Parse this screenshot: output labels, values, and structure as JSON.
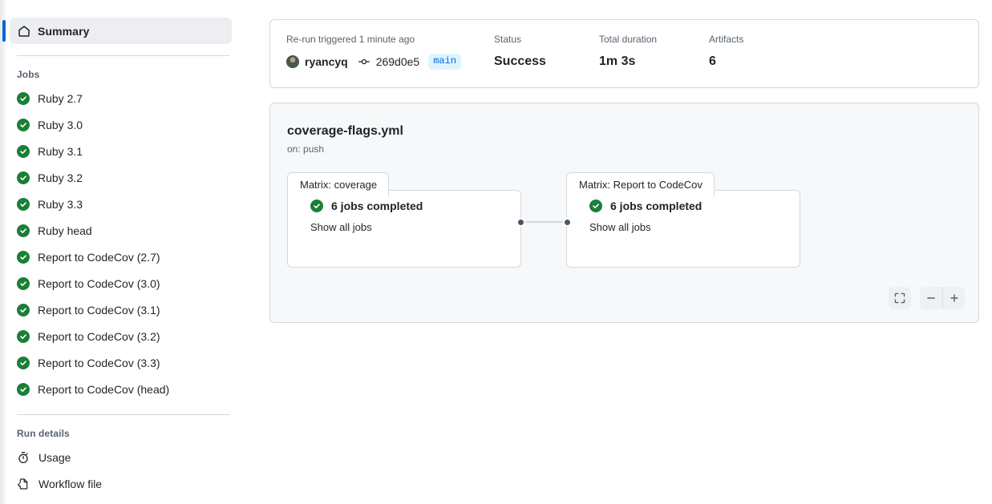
{
  "sidebar": {
    "summary": {
      "label": "Summary",
      "icon": "home-icon",
      "active": true
    },
    "jobs_heading": "Jobs",
    "jobs": [
      {
        "label": "Ruby 2.7",
        "status": "success"
      },
      {
        "label": "Ruby 3.0",
        "status": "success"
      },
      {
        "label": "Ruby 3.1",
        "status": "success"
      },
      {
        "label": "Ruby 3.2",
        "status": "success"
      },
      {
        "label": "Ruby 3.3",
        "status": "success"
      },
      {
        "label": "Ruby head",
        "status": "success"
      },
      {
        "label": "Report to CodeCov (2.7)",
        "status": "success"
      },
      {
        "label": "Report to CodeCov (3.0)",
        "status": "success"
      },
      {
        "label": "Report to CodeCov (3.1)",
        "status": "success"
      },
      {
        "label": "Report to CodeCov (3.2)",
        "status": "success"
      },
      {
        "label": "Report to CodeCov (3.3)",
        "status": "success"
      },
      {
        "label": "Report to CodeCov (head)",
        "status": "success"
      }
    ],
    "run_details_heading": "Run details",
    "run_details": [
      {
        "label": "Usage",
        "icon": "stopwatch-icon"
      },
      {
        "label": "Workflow file",
        "icon": "file-code-icon"
      }
    ]
  },
  "run_header": {
    "trigger_label": "Re-run triggered 1 minute ago",
    "actor": "ryancyq",
    "commit_sha": "269d0e5",
    "branch": "main",
    "status_label": "Status",
    "status_value": "Success",
    "duration_label": "Total duration",
    "duration_value": "1m 3s",
    "artifacts_label": "Artifacts",
    "artifacts_value": "6"
  },
  "workflow": {
    "title": "coverage-flags.yml",
    "trigger": "on: push",
    "nodes": [
      {
        "group_label": "Matrix: coverage",
        "status": "success",
        "summary": "6 jobs completed",
        "link": "Show all jobs"
      },
      {
        "group_label": "Matrix: Report to CodeCov",
        "status": "success",
        "summary": "6 jobs completed",
        "link": "Show all jobs"
      }
    ],
    "zoom_controls": {
      "fit": "fit-to-screen-icon",
      "zoom_out": "minus-icon",
      "zoom_in": "plus-icon"
    }
  },
  "colors": {
    "accent": "#0969da",
    "success": "#1a7f37",
    "border": "#d1d9e0",
    "canvas_bg": "#f6f8fa",
    "muted_text": "#59636e"
  }
}
